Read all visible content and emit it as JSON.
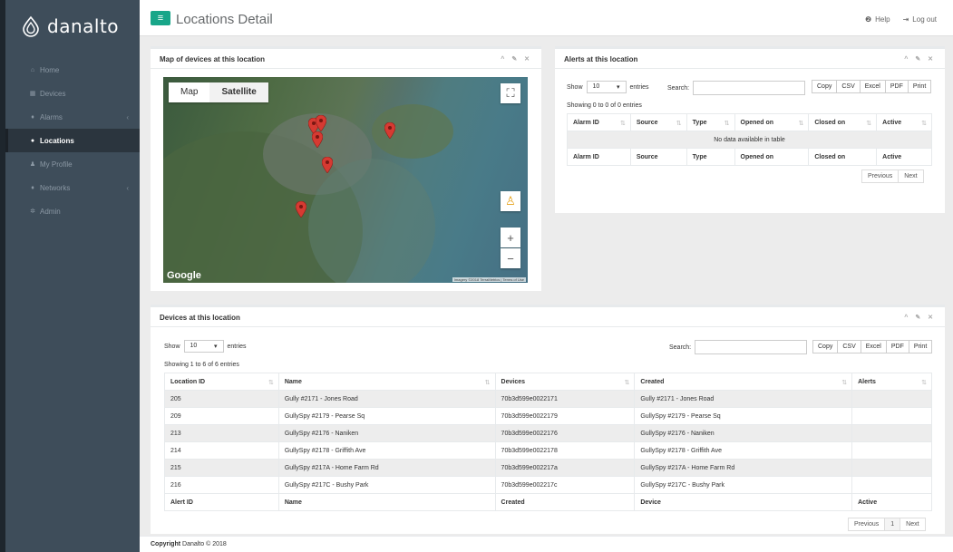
{
  "brand": {
    "name": "danalto"
  },
  "sidebar": {
    "items": [
      {
        "label": "Home",
        "icon": "home-icon",
        "glyph": "⌂"
      },
      {
        "label": "Devices",
        "icon": "grid-icon",
        "glyph": "▦"
      },
      {
        "label": "Alarms",
        "icon": "bell-icon",
        "glyph": "♦",
        "chevron": "‹"
      },
      {
        "label": "Locations",
        "icon": "map-marker-icon",
        "glyph": "●"
      },
      {
        "label": "My Profile",
        "icon": "user-icon",
        "glyph": "♟"
      },
      {
        "label": "Networks",
        "icon": "network-icon",
        "glyph": "♦",
        "chevron": "‹"
      },
      {
        "label": "Admin",
        "icon": "gear-icon",
        "glyph": "✲"
      }
    ]
  },
  "header": {
    "title": "Locations Detail",
    "menu_glyph": "≡",
    "help": "Help",
    "help_glyph": "❷",
    "logout": "Log out",
    "logout_glyph": "⇥"
  },
  "map_panel": {
    "title": "Map of devices at this location",
    "tools": "^ ✎ ✕",
    "map_label": "Map",
    "satellite_label": "Satellite",
    "google": "Google",
    "attribution": "Imagery ©2018 TerraMetrics | Terms of Use",
    "fullscreen_glyph": "⛶",
    "streetview_glyph": "♙",
    "zoom_in": "+",
    "zoom_out": "−"
  },
  "alerts_panel": {
    "title": "Alerts at this location",
    "tools": "^ ✎ ✕",
    "show": "Show",
    "entries_value": "10",
    "entries_label": "entries",
    "search": "Search:",
    "info": "Showing 0 to 0 of 0 entries",
    "buttons": [
      "Copy",
      "CSV",
      "Excel",
      "PDF",
      "Print"
    ],
    "columns": [
      "Alarm ID",
      "Source",
      "Type",
      "Opened on",
      "Closed on",
      "Active"
    ],
    "empty": "No data available in table",
    "footer_columns": [
      "Alarm ID",
      "Source",
      "Type",
      "Opened on",
      "Closed on",
      "Active"
    ],
    "prev": "Previous",
    "next": "Next"
  },
  "devices_panel": {
    "title": "Devices at this location",
    "tools": "^ ✎ ✕",
    "show": "Show",
    "entries_value": "10",
    "entries_label": "entries",
    "search": "Search:",
    "info": "Showing 1 to 6 of 6 entries",
    "buttons": [
      "Copy",
      "CSV",
      "Excel",
      "PDF",
      "Print"
    ],
    "columns": [
      "Location ID",
      "Name",
      "Devices",
      "Created",
      "Alerts"
    ],
    "rows": [
      [
        "205",
        "Gully #2171 - Jones Road",
        "70b3d599e0022171",
        "Gully #2171 - Jones Road",
        ""
      ],
      [
        "209",
        "GullySpy #2179 - Pearse Sq",
        "70b3d599e0022179",
        "GullySpy #2179 - Pearse Sq",
        ""
      ],
      [
        "213",
        "GullySpy #2176 - Naniken",
        "70b3d599e0022176",
        "GullySpy #2176 - Naniken",
        ""
      ],
      [
        "214",
        "GullySpy #2178 - Griffith Ave",
        "70b3d599e0022178",
        "GullySpy #2178 - Griffith Ave",
        ""
      ],
      [
        "215",
        "GullySpy #217A - Home Farm Rd",
        "70b3d599e002217a",
        "GullySpy #217A - Home Farm Rd",
        ""
      ],
      [
        "216",
        "GullySpy #217C - Bushy Park",
        "70b3d599e002217c",
        "GullySpy #217C - Bushy Park",
        ""
      ]
    ],
    "footer_columns": [
      "Alert ID",
      "Name",
      "Created",
      "Device",
      "Active"
    ],
    "prev": "Previous",
    "page": "1",
    "next": "Next"
  },
  "footer": {
    "prefix": "Copyright",
    "text": "Danalto © 2018"
  },
  "colors": {
    "accent": "#18a689",
    "sidebar": "#3e4d5a",
    "pin": "#d63a32"
  },
  "sort_glyph": "⇅"
}
